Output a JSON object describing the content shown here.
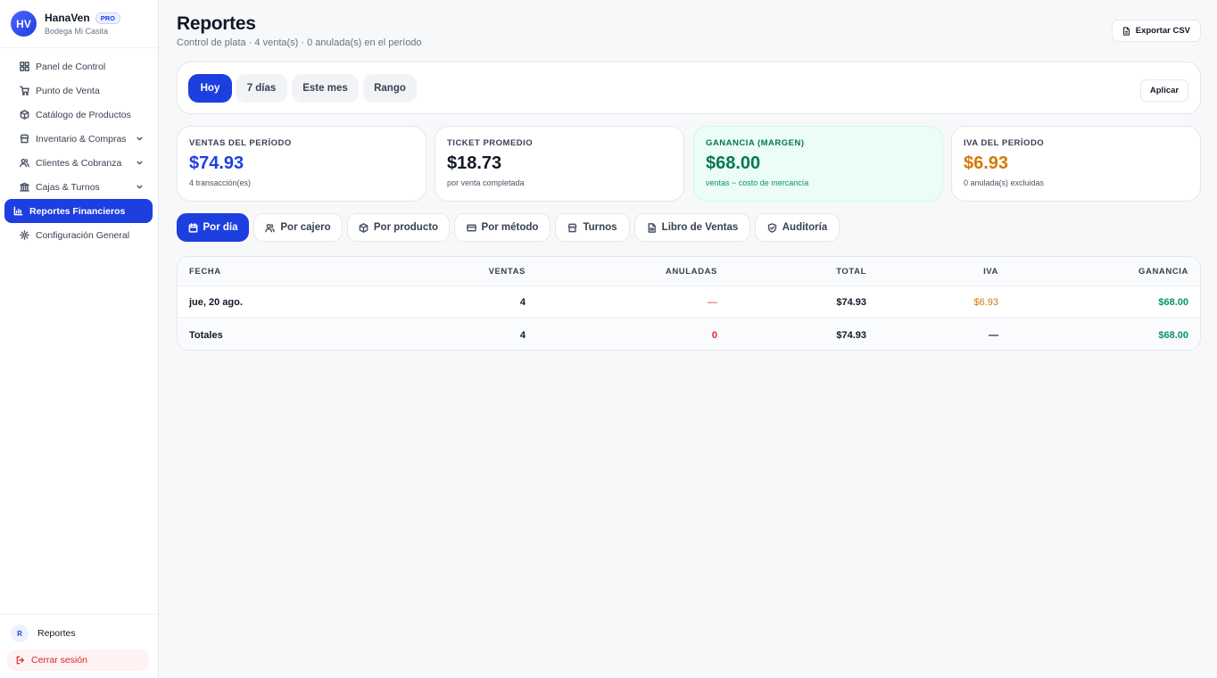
{
  "brand": {
    "initials": "HV",
    "name": "HanaVen",
    "badge": "PRO",
    "store": "Bodega Mi Casita"
  },
  "sidebar": {
    "items": [
      {
        "label": "Panel de Control",
        "icon": "grid-icon"
      },
      {
        "label": "Punto de Venta",
        "icon": "cart-icon"
      },
      {
        "label": "Catálogo de Productos",
        "icon": "box-icon"
      },
      {
        "label": "Inventario & Compras",
        "icon": "store-icon",
        "expandable": true
      },
      {
        "label": "Clientes & Cobranza",
        "icon": "users-icon",
        "expandable": true
      },
      {
        "label": "Cajas & Turnos",
        "icon": "bank-icon",
        "expandable": true
      },
      {
        "label": "Reportes Financieros",
        "icon": "bar-chart-icon",
        "active": true
      },
      {
        "label": "Configuración General",
        "icon": "gear-icon"
      }
    ]
  },
  "user": {
    "initial": "R",
    "name": "Reportes"
  },
  "logout_label": "Cerrar sesión",
  "header": {
    "title": "Reportes",
    "subtitle": "Control de plata · 4 venta(s) · 0 anulada(s) en el período",
    "export_label": "Exportar CSV"
  },
  "period": {
    "options": [
      "Hoy",
      "7 días",
      "Este mes",
      "Rango"
    ],
    "selected": "Hoy",
    "apply_label": "Aplicar"
  },
  "stats": [
    {
      "label": "VENTAS DEL PERÍODO",
      "value": "$74.93",
      "note": "4 transacción(es)",
      "color": "#1d3fe0"
    },
    {
      "label": "TICKET PROMEDIO",
      "value": "$18.73",
      "note": "por venta completada",
      "color": "#111827"
    },
    {
      "label": "GANANCIA (MARGEN)",
      "value": "$68.00",
      "note": "ventas − costo de mercancía",
      "color": "#047857"
    },
    {
      "label": "IVA DEL PERÍODO",
      "value": "$6.93",
      "note": "0 anulada(s) excluidas",
      "color": "#d97706"
    }
  ],
  "report_tabs": [
    {
      "label": "Por día",
      "icon": "calendar-icon",
      "active": true
    },
    {
      "label": "Por cajero",
      "icon": "users-icon"
    },
    {
      "label": "Por producto",
      "icon": "box-icon"
    },
    {
      "label": "Por método",
      "icon": "card-icon"
    },
    {
      "label": "Turnos",
      "icon": "store-icon"
    },
    {
      "label": "Libro de Ventas",
      "icon": "document-icon"
    },
    {
      "label": "Auditoría",
      "icon": "shield-icon"
    }
  ],
  "table": {
    "columns": [
      "FECHA",
      "VENTAS",
      "ANULADAS",
      "TOTAL",
      "IVA",
      "GANANCIA"
    ],
    "rows": [
      {
        "fecha": "jue, 20 ago.",
        "ventas": "4",
        "anuladas": "—",
        "total": "$74.93",
        "iva": "$6.93",
        "ganancia": "$68.00"
      }
    ],
    "totals": {
      "fecha": "Totales",
      "ventas": "4",
      "anuladas": "0",
      "total": "$74.93",
      "iva": "—",
      "ganancia": "$68.00"
    }
  },
  "colors": {
    "accent": "#1d3fe0",
    "green": "#059669",
    "orange": "#d97706",
    "red": "#dc2626"
  }
}
